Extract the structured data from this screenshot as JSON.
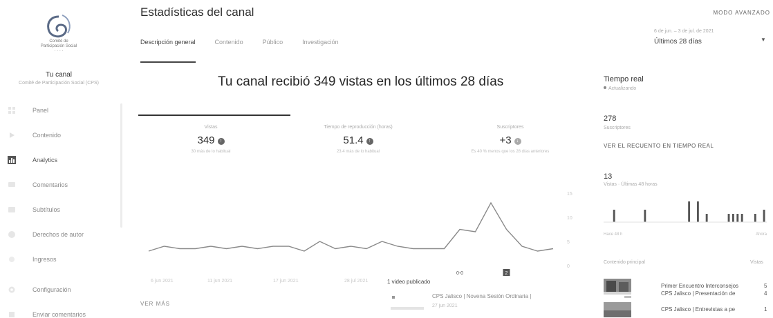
{
  "sidebar": {
    "channel_label": "Tu canal",
    "channel_name": "Comité de Participación Social (CPS)",
    "items": [
      {
        "label": "Panel",
        "icon": "dashboard-icon"
      },
      {
        "label": "Contenido",
        "icon": "video-icon"
      },
      {
        "label": "Analytics",
        "icon": "analytics-icon",
        "active": true
      },
      {
        "label": "Comentarios",
        "icon": "comments-icon"
      },
      {
        "label": "Subtítulos",
        "icon": "subtitles-icon"
      },
      {
        "label": "Derechos de autor",
        "icon": "copyright-icon"
      },
      {
        "label": "Ingresos",
        "icon": "money-icon"
      },
      {
        "label": "Configuración",
        "icon": "gear-icon"
      },
      {
        "label": "Enviar comentarios",
        "icon": "feedback-icon"
      }
    ]
  },
  "header": {
    "title": "Estadísticas del canal",
    "advanced_mode": "MODO AVANZADO",
    "tabs": [
      "Descripción general",
      "Contenido",
      "Público",
      "Investigación"
    ],
    "date_range_sub": "6 de jun. – 3 de jul. de 2021",
    "date_range": "Últimos 28 días"
  },
  "headline": "Tu canal recibió 349 vistas en los últimos 28 días",
  "metrics": [
    {
      "label": "Vistas",
      "value": "349",
      "sub": "30 más de lo habitual"
    },
    {
      "label": "Tiempo de reproducción (horas)",
      "value": "51.4",
      "sub": "23.4 más de lo habitual"
    },
    {
      "label": "Suscriptores",
      "value": "+3",
      "sub": "Es 40 % menos que los 28 días anteriores"
    }
  ],
  "chart_data": {
    "type": "line",
    "x_labels": [
      "6 jun 2021",
      "11 jun 2021",
      "17 jun 2021",
      "28 jul 2021"
    ],
    "series": [
      {
        "values": [
          3,
          4,
          3.5,
          3.5,
          4,
          3.5,
          4,
          3.5,
          4,
          4,
          3,
          5,
          3.5,
          4,
          3.5,
          5,
          4,
          3.5,
          3.5,
          3.5,
          7.5,
          7,
          13,
          7.5,
          4,
          3,
          3.5
        ]
      }
    ],
    "y_ticks": [
      "15",
      "10",
      "5",
      "0"
    ],
    "ylim": [
      0,
      15
    ],
    "markers": [
      {
        "label": "0-0",
        "index": 20
      },
      {
        "label": "2",
        "index": 23
      }
    ],
    "grid": false
  },
  "published_label": "1 video publicado",
  "see_more": "VER MÁS",
  "published_video": {
    "title": "CPS Jalisco | Novena Sesión Ordinaria |",
    "date": "27 jun 2021"
  },
  "realtime": {
    "title": "Tiempo real",
    "updating": "Actualizando",
    "subs_count": "278",
    "subs_label": "Suscriptores",
    "link": "VER EL RECUENTO EN TIEMPO REAL",
    "views_count": "13",
    "views_label": "Vistas · Últimas 48 horas",
    "bars": [
      0,
      0,
      3,
      0,
      0,
      0,
      0,
      0,
      0,
      3,
      0,
      0,
      0,
      0,
      0,
      0,
      0,
      0,
      0,
      5,
      0,
      5,
      0,
      2,
      0,
      0,
      0,
      0,
      2,
      2,
      2,
      2,
      0,
      0,
      2,
      0,
      3
    ],
    "mini_left": "Hace 48 h",
    "mini_right": "Ahora",
    "list_head_left": "Contenido principal",
    "list_head_right": "Vistas",
    "rows": [
      {
        "title": "Primer Encuentro Interconsejos",
        "value": "5"
      },
      {
        "title": "CPS Jalisco | Presentación de",
        "value": "4"
      },
      {
        "title": "CPS Jalisco | Entrevistas a pe",
        "value": "1"
      }
    ]
  }
}
